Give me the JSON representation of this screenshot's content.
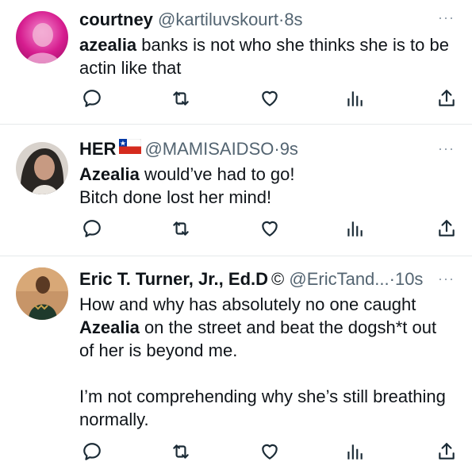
{
  "tweets": [
    {
      "display_name": "courtney",
      "handle": "@kartiluvskourt",
      "separator": "·",
      "time": "8s",
      "more_label": "···",
      "avatar_color": "#e0279b",
      "body_lines": [
        {
          "bold": "azealia",
          "rest": " banks is not who she thinks she is to be actin like that"
        }
      ]
    },
    {
      "display_name": "HER",
      "flag_icon": "chile-flag-icon",
      "handle": "@MAMISAIDSO",
      "separator": "·",
      "time": "9s",
      "more_label": "···",
      "avatar_color": "#2a2623",
      "body_lines": [
        {
          "bold": "Azealia",
          "rest": " would’ve had to go!"
        },
        {
          "bold": "",
          "rest": "Bitch done lost her mind!"
        }
      ]
    },
    {
      "display_name": "Eric T. Turner, Jr., Ed.D",
      "badge": "©",
      "handle": "@EricTand...",
      "separator": "·",
      "time": "10s",
      "more_label": "···",
      "avatar_color": "#b98456",
      "body_lines": [
        {
          "bold": "",
          "rest": "How and why has absolutely no one caught"
        },
        {
          "bold": "Azealia",
          "rest": " on the street and beat the dogsh*t out of her is beyond me."
        }
      ],
      "body_para2": "I’m not comprehending why she’s still breathing normally."
    }
  ],
  "action_icons": [
    "reply-icon",
    "retweet-icon",
    "like-icon",
    "views-icon",
    "share-icon"
  ],
  "colors": {
    "text": "#0f1419",
    "secondary": "#536471",
    "divider": "#e6e9eb",
    "icon": "#1b2b36"
  }
}
